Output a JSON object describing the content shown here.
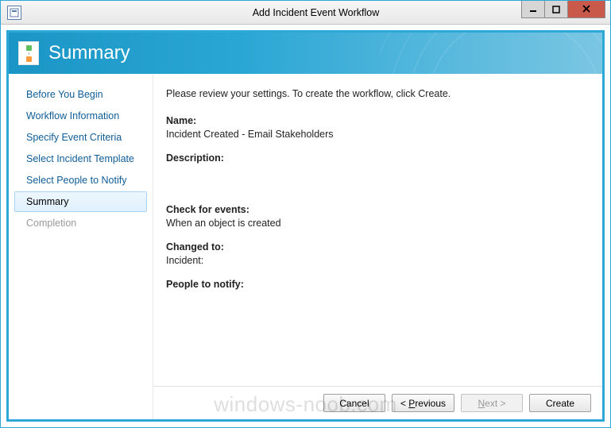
{
  "window": {
    "title": "Add Incident Event Workflow"
  },
  "banner": {
    "title": "Summary"
  },
  "nav": {
    "items": [
      {
        "label": "Before You Begin",
        "state": "normal"
      },
      {
        "label": "Workflow Information",
        "state": "normal"
      },
      {
        "label": "Specify Event Criteria",
        "state": "normal"
      },
      {
        "label": "Select Incident Template",
        "state": "normal"
      },
      {
        "label": "Select People to Notify",
        "state": "normal"
      },
      {
        "label": "Summary",
        "state": "selected"
      },
      {
        "label": "Completion",
        "state": "disabled"
      }
    ]
  },
  "content": {
    "intro": "Please review your settings. To create the workflow, click Create.",
    "name_label": "Name:",
    "name_value": "Incident Created - Email Stakeholders",
    "description_label": "Description:",
    "description_value": "",
    "check_label": "Check for events:",
    "check_value": "When an object is created",
    "changed_label": "Changed to:",
    "changed_value": "Incident:",
    "people_label": "People to notify:",
    "people_value": ""
  },
  "buttons": {
    "cancel": "Cancel",
    "previous_prefix": "< ",
    "previous_key": "P",
    "previous_rest": "revious",
    "next_key": "N",
    "next_rest": "ext >",
    "create": "Create"
  },
  "watermark": "windows-noob.com"
}
